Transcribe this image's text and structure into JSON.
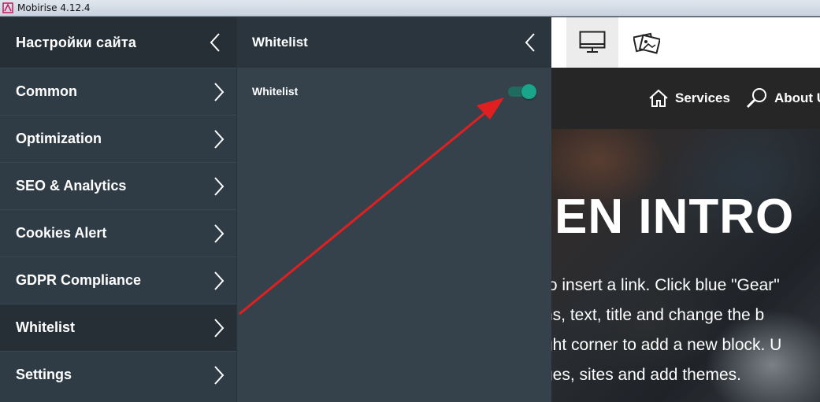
{
  "window": {
    "title": "Mobirise 4.12.4"
  },
  "sidebar": {
    "title": "Настройки сайта",
    "items": [
      {
        "label": "Common"
      },
      {
        "label": "Optimization"
      },
      {
        "label": "SEO & Analytics"
      },
      {
        "label": "Cookies Alert"
      },
      {
        "label": "GDPR Compliance"
      },
      {
        "label": "Whitelist",
        "active": true
      },
      {
        "label": "Settings"
      }
    ]
  },
  "submenu": {
    "title": "Whitelist",
    "option_label": "Whitelist",
    "toggle_on": true,
    "toggle_color": "#1aa58b"
  },
  "preview": {
    "toolbar": {
      "buttons": [
        "desktop-icon",
        "images-icon"
      ]
    },
    "nav": [
      {
        "label": "Services",
        "icon": "home-icon"
      },
      {
        "label": "About U",
        "icon": "search-icon"
      }
    ],
    "hero_title": "EN INTRO",
    "hero_lines": [
      "to insert a link. Click blue \"Gear\"",
      "ns, text, title and change the b",
      "ght corner to add a new block. U",
      "ges, sites and add themes."
    ]
  },
  "annotation": {
    "color": "#e02020",
    "icon": "red-arrow"
  }
}
